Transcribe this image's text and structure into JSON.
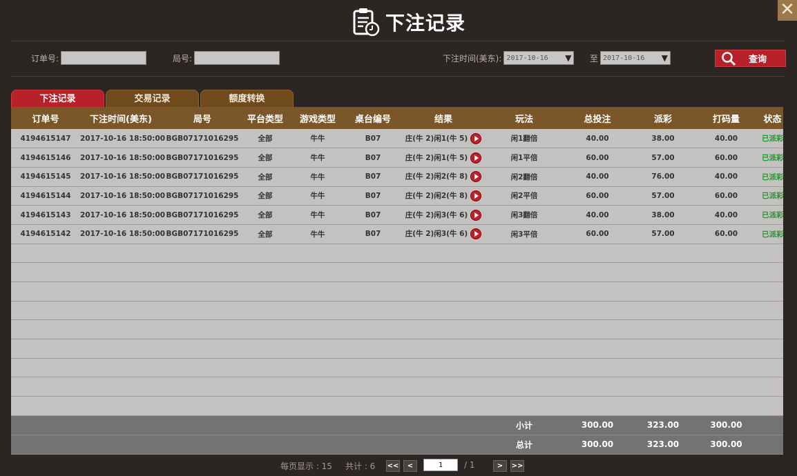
{
  "header": {
    "title": "下注记录",
    "close_label": "✕"
  },
  "filters": {
    "order_no_label": "订单号:",
    "order_no_value": "",
    "round_label": "局号:",
    "round_value": "",
    "time_label": "下注时间(美东):",
    "time_from": "2017-10-16",
    "to_label": "至",
    "time_to": "2017-10-16",
    "search_label": "查询"
  },
  "tabs": [
    {
      "label": "下注记录",
      "active": true
    },
    {
      "label": "交易记录",
      "active": false
    },
    {
      "label": "额度转换",
      "active": false
    }
  ],
  "table": {
    "columns": [
      "订单号",
      "下注时间(美东)",
      "局号",
      "平台类型",
      "游戏类型",
      "桌台编号",
      "结果",
      "玩法",
      "总投注",
      "派彩",
      "打码量",
      "状态"
    ],
    "rows": [
      [
        "4194615147",
        "2017-10-16 18:50:00",
        "BGB07171016295",
        "全部",
        "牛牛",
        "B07",
        "庄(牛 2)闲1(牛 5)",
        "闲1翻倍",
        "40.00",
        "38.00",
        "40.00",
        "已派彩"
      ],
      [
        "4194615146",
        "2017-10-16 18:50:00",
        "BGB07171016295",
        "全部",
        "牛牛",
        "B07",
        "庄(牛 2)闲1(牛 5)",
        "闲1平倍",
        "60.00",
        "57.00",
        "60.00",
        "已派彩"
      ],
      [
        "4194615145",
        "2017-10-16 18:50:00",
        "BGB07171016295",
        "全部",
        "牛牛",
        "B07",
        "庄(牛 2)闲2(牛 8)",
        "闲2翻倍",
        "40.00",
        "76.00",
        "40.00",
        "已派彩"
      ],
      [
        "4194615144",
        "2017-10-16 18:50:00",
        "BGB07171016295",
        "全部",
        "牛牛",
        "B07",
        "庄(牛 2)闲2(牛 8)",
        "闲2平倍",
        "60.00",
        "57.00",
        "60.00",
        "已派彩"
      ],
      [
        "4194615143",
        "2017-10-16 18:50:00",
        "BGB07171016295",
        "全部",
        "牛牛",
        "B07",
        "庄(牛 2)闲3(牛 6)",
        "闲3翻倍",
        "40.00",
        "38.00",
        "40.00",
        "已派彩"
      ],
      [
        "4194615142",
        "2017-10-16 18:50:00",
        "BGB07171016295",
        "全部",
        "牛牛",
        "B07",
        "庄(牛 2)闲3(牛 6)",
        "闲3平倍",
        "60.00",
        "57.00",
        "60.00",
        "已派彩"
      ]
    ],
    "subtotal": {
      "label": "小计",
      "bet": "300.00",
      "payout": "323.00",
      "valid": "300.00"
    },
    "total": {
      "label": "总计",
      "bet": "300.00",
      "payout": "323.00",
      "valid": "300.00"
    }
  },
  "pager": {
    "per_page": "每页显示 : 15",
    "total": "共计 : 6",
    "first": "<<",
    "prev": "<",
    "page": "1",
    "of": "/ 1",
    "next": ">",
    "last": ">>"
  },
  "colors": {
    "accent": "#b8202a",
    "header_brown": "#7a5628",
    "status_green": "#1f9a2a"
  }
}
